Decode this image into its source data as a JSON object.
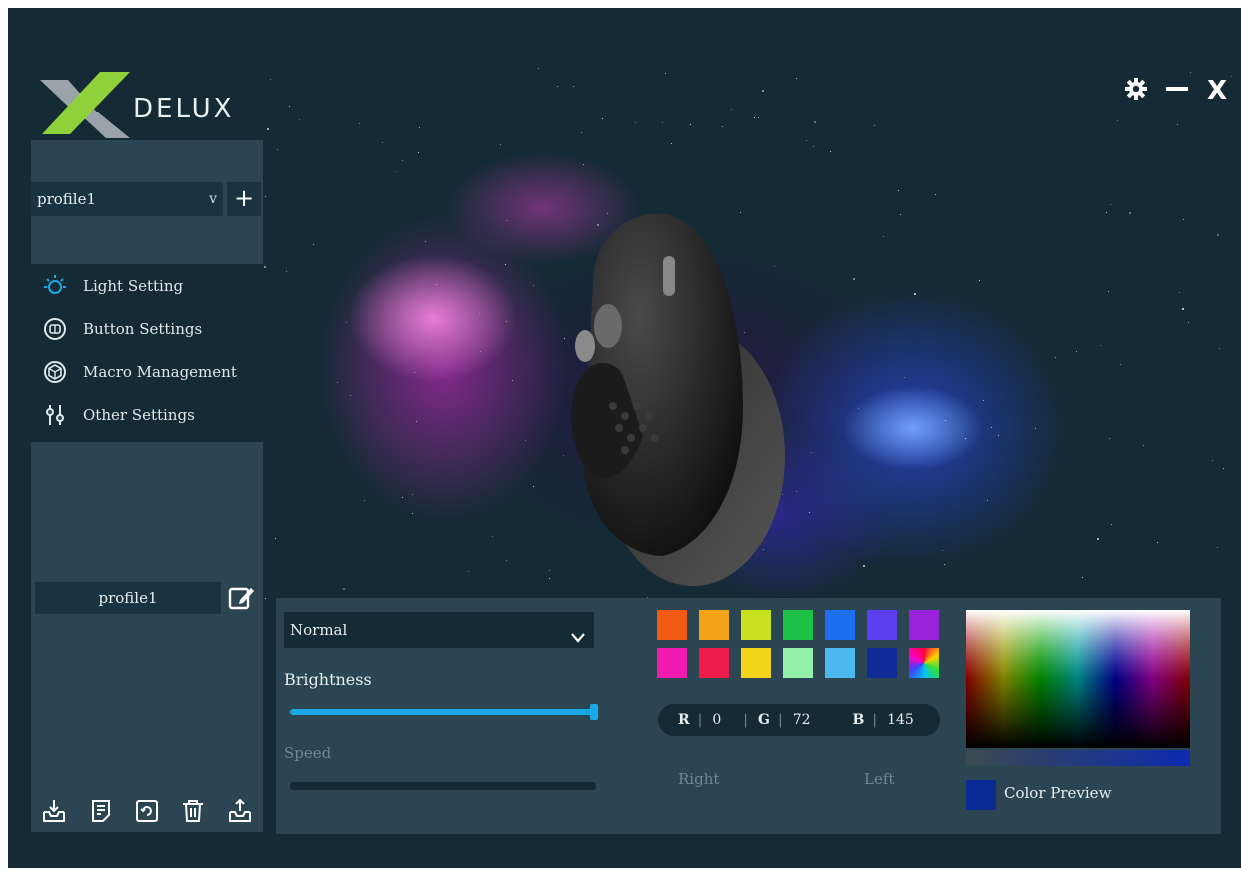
{
  "brand": {
    "logo_text": "DELUX"
  },
  "window_controls": {
    "settings_icon": "gear-icon",
    "minimize_icon": "minimize-icon",
    "close_icon": "close-icon",
    "close_label": "X"
  },
  "profile": {
    "selected": "profile1",
    "dropdown_caret": "v",
    "add_label": "+",
    "name_box": "profile1"
  },
  "nav": {
    "items": [
      {
        "label": "Light Setting",
        "icon": "lightbulb-icon",
        "active": true
      },
      {
        "label": "Button Settings",
        "icon": "button-icon",
        "active": false
      },
      {
        "label": "Macro Management",
        "icon": "macro-icon",
        "active": false
      },
      {
        "label": "Other Settings",
        "icon": "sliders-icon",
        "active": false
      }
    ]
  },
  "bottom_toolbar": [
    "import-icon",
    "notes-icon",
    "refresh-icon",
    "delete-icon",
    "export-icon"
  ],
  "light": {
    "mode": "Normal",
    "brightness_label": "Brightness",
    "brightness_value": 1.0,
    "speed_label": "Speed",
    "speed_value": 0,
    "swatch_colors": [
      "#f25b13",
      "#f2a31a",
      "#c9e21f",
      "#1fc046",
      "#1c6ff0",
      "#5b3ff0",
      "#9a22d8",
      "#f01ab0",
      "#ef1c4b",
      "#f2d51a",
      "#93f0a8",
      "#4cb8f0",
      "#112a9a",
      "multicolor"
    ],
    "rgb": {
      "r_label": "R",
      "r": "0",
      "g_label": "G",
      "g": "72",
      "b_label": "B",
      "b": "145"
    },
    "right_label": "Right",
    "left_label": "Left",
    "preview_color": "#0b2a94",
    "preview_label": "Color Preview"
  }
}
